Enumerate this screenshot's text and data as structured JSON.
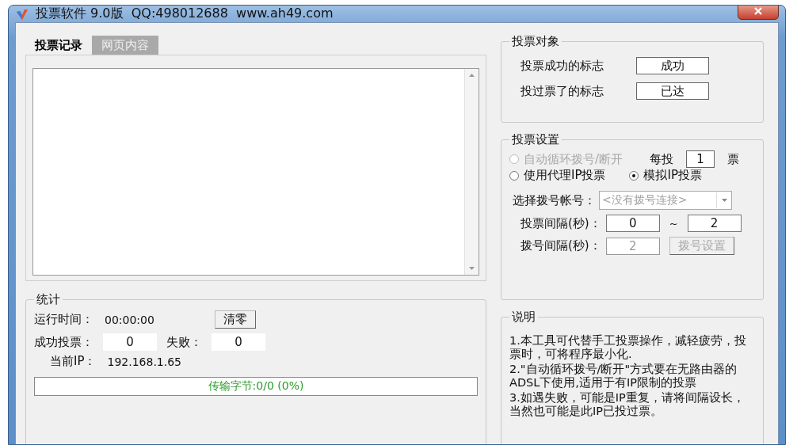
{
  "window": {
    "title": "投票软件 9.0版  QQ:498012688  www.ah49.com"
  },
  "tabs": [
    {
      "label": "投票记录",
      "selected": true
    },
    {
      "label": "网页内容",
      "selected": false
    }
  ],
  "stats": {
    "title": "统计",
    "runtime_label": "运行时间：",
    "runtime": "00:00:00",
    "reset_button": "清零",
    "success_label": "成功投票：",
    "success": "0",
    "fail_label": "失败：",
    "fail": "0",
    "ip_label": "当前IP：",
    "ip": "192.168.1.65",
    "progress": {
      "text": "传输字节:0/0 (0%)",
      "level": 0
    }
  },
  "target": {
    "title": "投票对象",
    "rows": [
      {
        "label": "投票成功的标志",
        "value": "成功"
      },
      {
        "label": "投过票了的标志",
        "value": "已达"
      }
    ]
  },
  "settings": {
    "title": "投票设置",
    "modes": [
      {
        "label": "自动循环拨号/断开",
        "selected": false,
        "disabled": true
      },
      {
        "label": "使用代理IP投票",
        "selected": false,
        "disabled": false
      },
      {
        "label": "模拟IP投票",
        "selected": true,
        "disabled": false
      }
    ],
    "per_vote_label": "每投",
    "per_vote": "1",
    "per_vote_unit": "票",
    "account": {
      "label": "选择拨号帐号：",
      "value": "<没有拨号连接>",
      "disabled": true
    },
    "vote_interval": {
      "label": "投票间隔(秒)：",
      "from": "0",
      "separator": "~",
      "to": "2"
    },
    "dial_interval": {
      "label": "拨号间隔(秒)：",
      "value": "2",
      "disabled": true
    },
    "dial_button": {
      "label": "拨号设置",
      "disabled": true
    }
  },
  "notes": {
    "title": "说明",
    "items": [
      "1.本工具可代替手工投票操作，减轻疲劳，投票时，可将程序最小化.",
      "2.\"自动循环拨号/断开\"方式要在无路由器的ADSL下使用,适用于有IP限制的投票",
      "3.如遇失败，可能是IP重复，请将间隔设长，当然也可能是此IP已投过票。"
    ]
  }
}
